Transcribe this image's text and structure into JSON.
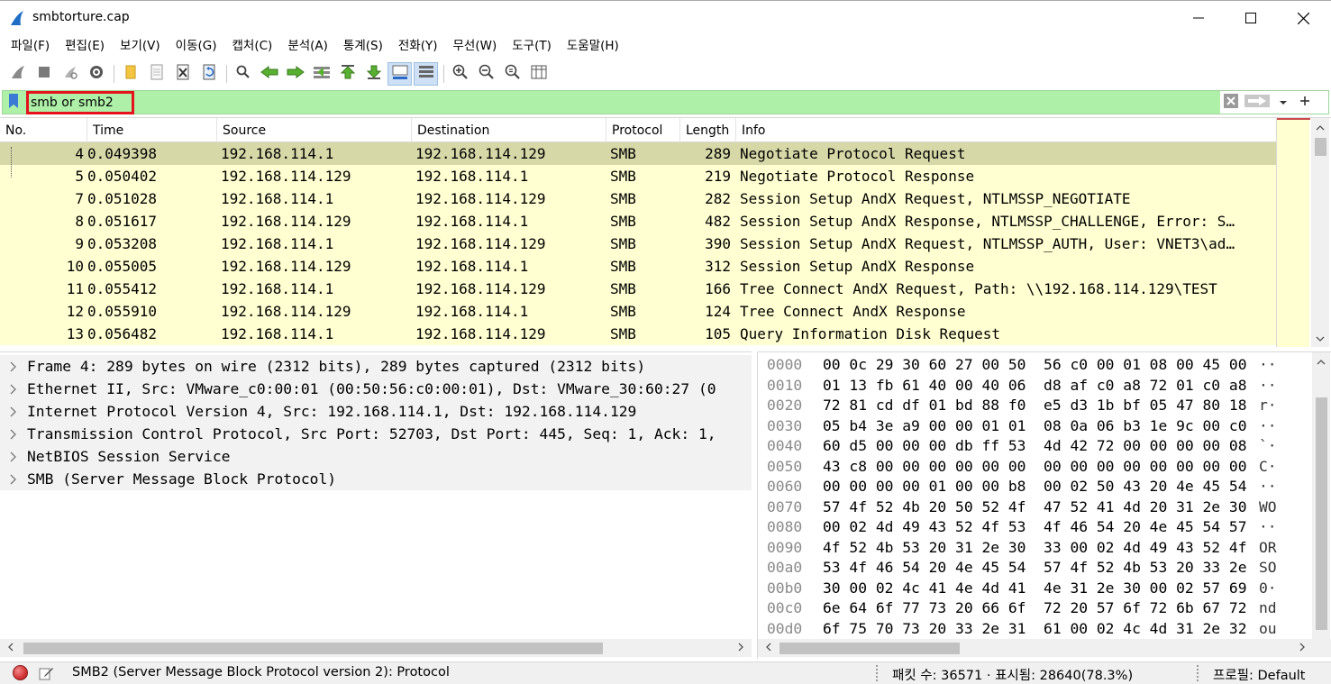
{
  "window": {
    "title": "smbtorture.cap"
  },
  "menu": [
    "파일(F)",
    "편집(E)",
    "보기(V)",
    "이동(G)",
    "캡처(C)",
    "분석(A)",
    "통계(S)",
    "전화(Y)",
    "무선(W)",
    "도구(T)",
    "도움말(H)"
  ],
  "filter": {
    "value": "smb or smb2"
  },
  "packet_list": {
    "columns": [
      "No.",
      "Time",
      "Source",
      "Destination",
      "Protocol",
      "Length",
      "Info"
    ],
    "rows": [
      {
        "no": "4",
        "time": "0.049398",
        "src": "192.168.114.1",
        "dst": "192.168.114.129",
        "proto": "SMB",
        "len": "289",
        "info": "Negotiate Protocol Request"
      },
      {
        "no": "5",
        "time": "0.050402",
        "src": "192.168.114.129",
        "dst": "192.168.114.1",
        "proto": "SMB",
        "len": "219",
        "info": "Negotiate Protocol Response"
      },
      {
        "no": "7",
        "time": "0.051028",
        "src": "192.168.114.1",
        "dst": "192.168.114.129",
        "proto": "SMB",
        "len": "282",
        "info": "Session Setup AndX Request, NTLMSSP_NEGOTIATE"
      },
      {
        "no": "8",
        "time": "0.051617",
        "src": "192.168.114.129",
        "dst": "192.168.114.1",
        "proto": "SMB",
        "len": "482",
        "info": "Session Setup AndX Response, NTLMSSP_CHALLENGE, Error: S…"
      },
      {
        "no": "9",
        "time": "0.053208",
        "src": "192.168.114.1",
        "dst": "192.168.114.129",
        "proto": "SMB",
        "len": "390",
        "info": "Session Setup AndX Request, NTLMSSP_AUTH, User: VNET3\\ad…"
      },
      {
        "no": "10",
        "time": "0.055005",
        "src": "192.168.114.129",
        "dst": "192.168.114.1",
        "proto": "SMB",
        "len": "312",
        "info": "Session Setup AndX Response"
      },
      {
        "no": "11",
        "time": "0.055412",
        "src": "192.168.114.1",
        "dst": "192.168.114.129",
        "proto": "SMB",
        "len": "166",
        "info": "Tree Connect AndX Request, Path: \\\\192.168.114.129\\TEST"
      },
      {
        "no": "12",
        "time": "0.055910",
        "src": "192.168.114.129",
        "dst": "192.168.114.1",
        "proto": "SMB",
        "len": "124",
        "info": "Tree Connect AndX Response"
      },
      {
        "no": "13",
        "time": "0.056482",
        "src": "192.168.114.1",
        "dst": "192.168.114.129",
        "proto": "SMB",
        "len": "105",
        "info": "Query Information Disk Request"
      }
    ]
  },
  "details": [
    "Frame 4: 289 bytes on wire (2312 bits), 289 bytes captured (2312 bits)",
    "Ethernet II, Src: VMware_c0:00:01 (00:50:56:c0:00:01), Dst: VMware_30:60:27 (0",
    "Internet Protocol Version 4, Src: 192.168.114.1, Dst: 192.168.114.129",
    "Transmission Control Protocol, Src Port: 52703, Dst Port: 445, Seq: 1, Ack: 1,",
    "NetBIOS Session Service",
    "SMB (Server Message Block Protocol)"
  ],
  "bytes": [
    {
      "off": "0000",
      "hex": "00 0c 29 30 60 27 00 50  56 c0 00 01 08 00 45 00",
      "asc": "··"
    },
    {
      "off": "0010",
      "hex": "01 13 fb 61 40 00 40 06  d8 af c0 a8 72 01 c0 a8",
      "asc": "··"
    },
    {
      "off": "0020",
      "hex": "72 81 cd df 01 bd 88 f0  e5 d3 1b bf 05 47 80 18",
      "asc": "r·"
    },
    {
      "off": "0030",
      "hex": "05 b4 3e a9 00 00 01 01  08 0a 06 b3 1e 9c 00 c0",
      "asc": "··"
    },
    {
      "off": "0040",
      "hex": "60 d5 00 00 00 db ff 53  4d 42 72 00 00 00 00 08",
      "asc": "`·"
    },
    {
      "off": "0050",
      "hex": "43 c8 00 00 00 00 00 00  00 00 00 00 00 00 00 00",
      "asc": "C·"
    },
    {
      "off": "0060",
      "hex": "00 00 00 00 01 00 00 b8  00 02 50 43 20 4e 45 54",
      "asc": "··"
    },
    {
      "off": "0070",
      "hex": "57 4f 52 4b 20 50 52 4f  47 52 41 4d 20 31 2e 30",
      "asc": "WO"
    },
    {
      "off": "0080",
      "hex": "00 02 4d 49 43 52 4f 53  4f 46 54 20 4e 45 54 57",
      "asc": "··"
    },
    {
      "off": "0090",
      "hex": "4f 52 4b 53 20 31 2e 30  33 00 02 4d 49 43 52 4f",
      "asc": "OR"
    },
    {
      "off": "00a0",
      "hex": "53 4f 46 54 20 4e 45 54  57 4f 52 4b 53 20 33 2e",
      "asc": "SO"
    },
    {
      "off": "00b0",
      "hex": "30 00 02 4c 41 4e 4d 41  4e 31 2e 30 00 02 57 69",
      "asc": "0·"
    },
    {
      "off": "00c0",
      "hex": "6e 64 6f 77 73 20 66 6f  72 20 57 6f 72 6b 67 72",
      "asc": "nd"
    },
    {
      "off": "00d0",
      "hex": "6f 75 70 73 20 33 2e 31  61 00 02 4c 4d 31 2e 32",
      "asc": "ou"
    }
  ],
  "status": {
    "field_info": "SMB2 (Server Message Block Protocol version 2): Protocol",
    "packets": "패킷 수: 36571 · 표시됨: 28640(78.3%)",
    "profile": "프로필: Default"
  },
  "colors": {
    "filter_valid_bg": "#aff0a8",
    "row_bg": "#ffffd2",
    "row_selected_bg": "#d7d8a8",
    "filter_highlight_border": "#e5131b"
  }
}
